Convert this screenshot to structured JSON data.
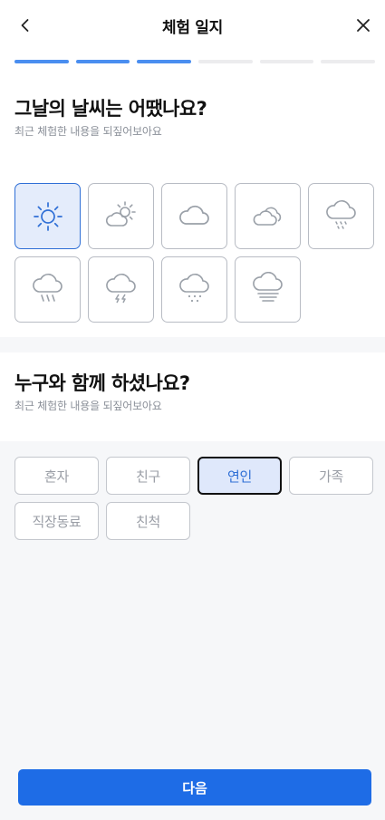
{
  "header": {
    "title": "체험 일지"
  },
  "progress": {
    "total_steps": 6,
    "completed_steps": 3
  },
  "weather_section": {
    "title": "그날의 날씨는 어땠나요?",
    "subtitle": "최근 체험한 내용을 되짚어보아요",
    "options": [
      {
        "icon": "sun-icon",
        "selected": true
      },
      {
        "icon": "partly-cloudy-icon",
        "selected": false
      },
      {
        "icon": "cloud-icon",
        "selected": false
      },
      {
        "icon": "cloudy-icon",
        "selected": false
      },
      {
        "icon": "drizzle-icon",
        "selected": false
      },
      {
        "icon": "rain-icon",
        "selected": false
      },
      {
        "icon": "thunderstorm-icon",
        "selected": false
      },
      {
        "icon": "snow-icon",
        "selected": false
      },
      {
        "icon": "fog-icon",
        "selected": false
      }
    ]
  },
  "company_section": {
    "title": "누구와 함께 하셨나요?",
    "subtitle": "최근 체험한 내용을 되짚어보아요",
    "options": [
      {
        "label": "혼자",
        "selected": false
      },
      {
        "label": "친구",
        "selected": false
      },
      {
        "label": "연인",
        "selected": true
      },
      {
        "label": "가족",
        "selected": false
      },
      {
        "label": "직장동료",
        "selected": false
      },
      {
        "label": "친척",
        "selected": false
      }
    ]
  },
  "footer": {
    "next_label": "다음"
  },
  "colors": {
    "accent": "#1e6ce6",
    "progress_on": "#4a8ef0",
    "selected_bg": "#e4ecfb"
  }
}
